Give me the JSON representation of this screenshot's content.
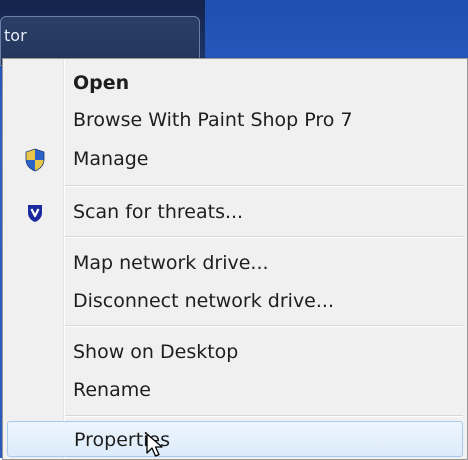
{
  "background": {
    "window_label": "tor"
  },
  "menu": {
    "items": [
      {
        "label": "Open",
        "icon": null,
        "bold": true
      },
      {
        "label": "Browse With Paint Shop Pro 7",
        "icon": null
      },
      {
        "label": "Manage",
        "icon": "uac-shield-icon"
      },
      {
        "label": "Scan for threats...",
        "icon": "antivirus-shield-icon"
      },
      {
        "label": "Map network drive...",
        "icon": null
      },
      {
        "label": "Disconnect network drive...",
        "icon": null
      },
      {
        "label": "Show on Desktop",
        "icon": null
      },
      {
        "label": "Rename",
        "icon": null
      },
      {
        "label": "Properties",
        "icon": null,
        "hovered": true
      }
    ]
  },
  "colors": {
    "menu_bg": "#f0f0f0",
    "hover_bg": "#dcebfb",
    "hover_border": "#a8c9ef",
    "desktop_blue": "#2d63c8"
  }
}
